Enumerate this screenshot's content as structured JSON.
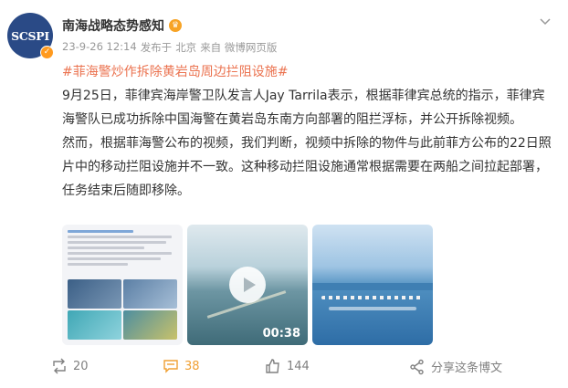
{
  "header": {
    "avatar_text": "SCSPI",
    "name": "南海战略态势感知",
    "time": "23-9-26 12:14",
    "source_prefix": "发布于",
    "location": "北京",
    "client": "来自 微博网页版"
  },
  "post": {
    "topic": "#菲海警炒作拆除黄岩岛周边拦阻设施#",
    "paragraph1": "9月25日，菲律宾海岸警卫队发言人Jay Tarrila表示，根据菲律宾总统的指示，菲律宾海警队已成功拆除中国海警在黄岩岛东南方向部署的阻拦浮标，并公开拆除视频。",
    "paragraph2": "然而，根据菲海警公布的视频，我们判断，视频中拆除的物件与此前菲方公布的22日照片中的移动拦阻设施并不一致。这种移动拦阻设施通常根据需要在两船之间拉起部署，任务结束后随即移除。"
  },
  "media": {
    "video_duration": "00:38"
  },
  "footer": {
    "repost_count": "20",
    "comment_count": "38",
    "like_count": "144",
    "share_label": "分享这条博文"
  },
  "colors": {
    "topic": "#eb7350",
    "active": "#f0a033",
    "muted": "#808080"
  }
}
